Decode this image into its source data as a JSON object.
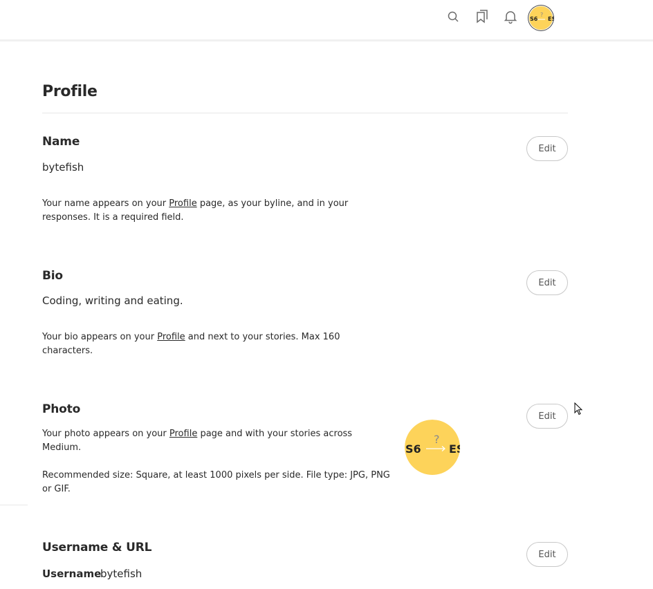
{
  "topbar": {
    "icons": [
      "search-icon",
      "bookmarks-icon",
      "bell-icon"
    ],
    "avatar": {
      "left_text": "S6",
      "right_text": "ES",
      "mark": "?",
      "bg": "#fdd35a"
    }
  },
  "page": {
    "title": "Profile"
  },
  "name_section": {
    "title": "Name",
    "value": "bytefish",
    "desc_before": "Your name appears on your ",
    "desc_link": "Profile",
    "desc_after_line1": " page, as your byline, and in your",
    "desc_line2": "responses. It is a required field.",
    "edit_label": "Edit"
  },
  "bio_section": {
    "title": "Bio",
    "value": "Coding, writing and eating.",
    "desc_before": "Your bio appears on your ",
    "desc_link": "Profile",
    "desc_after_line1": " and next to your stories. Max 160",
    "desc_line2": "characters.",
    "edit_label": "Edit"
  },
  "photo_section": {
    "title": "Photo",
    "desc_before": "Your photo appears on your ",
    "desc_link": "Profile",
    "desc_after_line1": " page and with your stories across",
    "desc_line2": "Medium.",
    "rec_line1": "Recommended size: Square, at least 1000 pixels per side. File type: JPG, PNG",
    "rec_line2": "or GIF.",
    "edit_label": "Edit"
  },
  "username_section": {
    "title": "Username & URL",
    "username_label": "Username",
    "username_value": "bytefish",
    "edit_label": "Edit"
  },
  "colors": {
    "accent_yellow": "#fdd35a",
    "text": "#292929",
    "border": "#c8c8c8"
  }
}
